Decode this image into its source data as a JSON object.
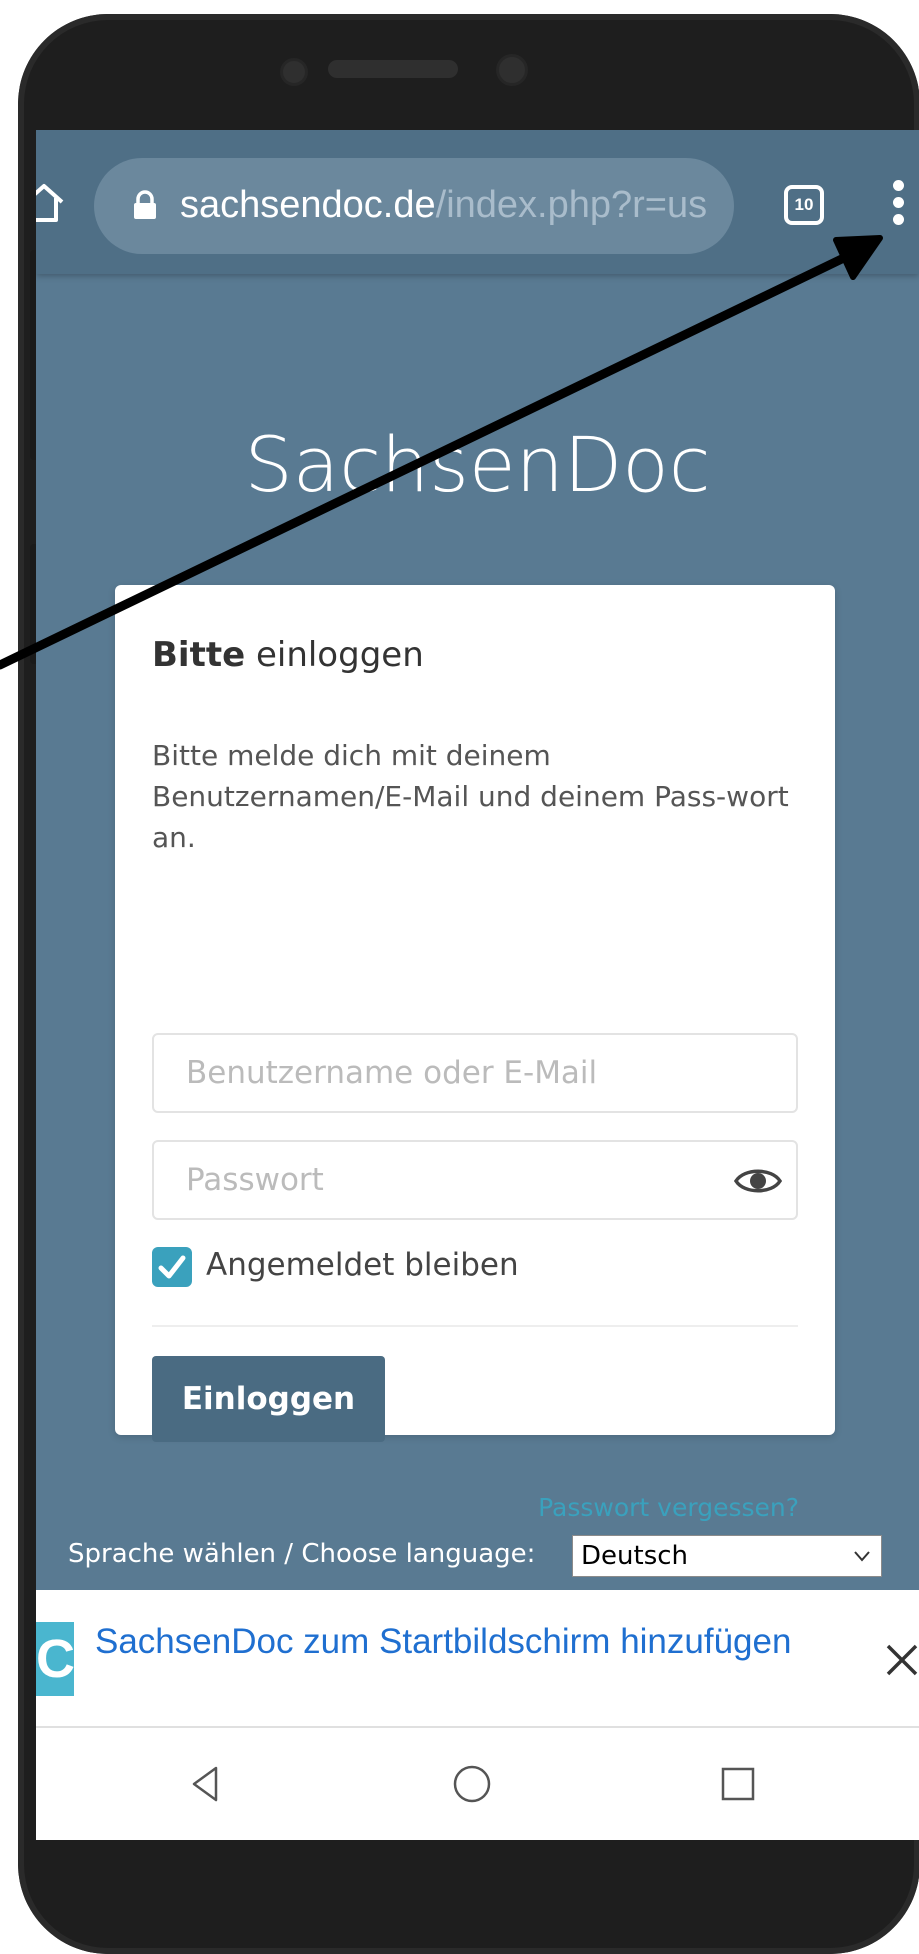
{
  "browser": {
    "url_domain": "sachsendoc.de",
    "url_path": "/index.php?r=us",
    "tab_count": "10",
    "icons": [
      "home-icon",
      "lock-icon",
      "tabs-icon",
      "menu-icon"
    ]
  },
  "site": {
    "title": "SachsenDoc"
  },
  "login": {
    "heading_bold": "Bitte",
    "heading_rest": " einloggen",
    "intro": "Bitte melde dich mit deinem Benutzernamen/E-Mail und deinem Pass-wort an.",
    "username_placeholder": "Benutzername oder E-Mail",
    "password_placeholder": "Passwort",
    "remember_label": "Angemeldet bleiben",
    "remember_checked": true,
    "submit_label": "Einloggen",
    "forgot_label": "Passwort vergessen?"
  },
  "language": {
    "label": "Sprache wählen / Choose language:",
    "selected": "Deutsch"
  },
  "install_banner": {
    "logo_letter": "C",
    "text": "SachsenDoc zum Startbildschirm hinzufügen"
  },
  "colors": {
    "page_background": "#597a92",
    "toolbar": "#4f6f86",
    "accent": "#3aa1bd",
    "button": "#4a6b82",
    "banner_link": "#1f6fd0"
  }
}
